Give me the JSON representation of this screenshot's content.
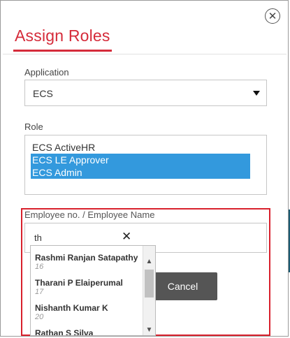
{
  "dialog": {
    "title": "Assign Roles",
    "close_glyph": "✕"
  },
  "application": {
    "label": "Application",
    "selected": "ECS"
  },
  "role": {
    "label": "Role",
    "options": [
      {
        "label": "ECS ActiveHR",
        "selected": false
      },
      {
        "label": "ECS LE Approver",
        "selected": true
      },
      {
        "label": "ECS Admin",
        "selected": true
      }
    ]
  },
  "employee": {
    "label": "Employee no. / Employee Name",
    "value": "th",
    "clear_glyph": "✕",
    "suggestions": [
      {
        "name": "Rashmi Ranjan Satapathy",
        "number": "16"
      },
      {
        "name": "Tharani P Elaiperumal",
        "number": "17"
      },
      {
        "name": "Nishanth Kumar K",
        "number": "20"
      },
      {
        "name": "Rathan S Silva",
        "number": ""
      }
    ]
  },
  "actions": {
    "cancel_label": "Cancel"
  },
  "icons": {
    "close": "close-icon",
    "clear": "clear-icon",
    "dropdown": "chevron-down-icon"
  },
  "colors": {
    "accent": "#d52b3a",
    "selection": "#3399dd",
    "button": "#555555",
    "highlight_border": "#d8202c"
  }
}
